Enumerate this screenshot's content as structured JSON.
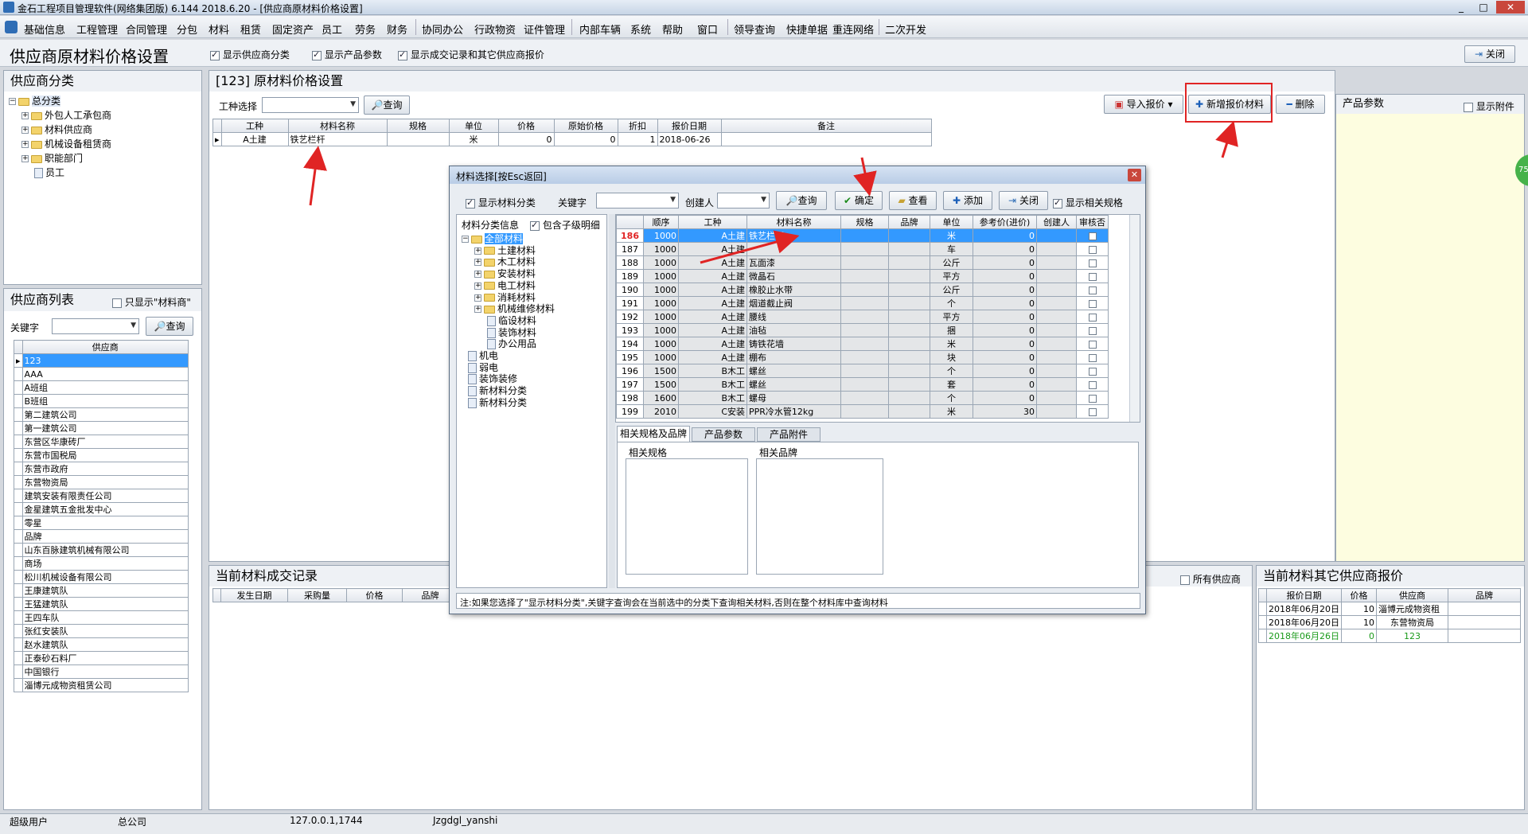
{
  "window": {
    "title": "金石工程项目管理软件(网络集团版) 6.144  2018.6.20 - [供应商原材料价格设置]"
  },
  "menu": [
    "基础信息",
    "工程管理",
    "合同管理",
    "分包",
    "材料",
    "租赁",
    "固定资产",
    "员工",
    "劳务",
    "财务",
    "协同办公",
    "行政物资",
    "证件管理",
    "内部车辆",
    "系统",
    "帮助",
    "窗口",
    "领导查询",
    "快捷单据",
    "重连网络",
    "二次开发"
  ],
  "header": {
    "title": "供应商原材料价格设置",
    "opt1": "显示供应商分类",
    "opt2": "显示产品参数",
    "opt3": "显示成交记录和其它供应商报价",
    "close": "关闭"
  },
  "supplier_category": {
    "title": "供应商分类",
    "root": "总分类",
    "items": [
      "外包人工承包商",
      "材料供应商",
      "机械设备租赁商",
      "职能部门",
      "员工"
    ]
  },
  "supplier_list": {
    "title": "供应商列表",
    "only_material": "只显示\"材料商\"",
    "keyword_label": "关键字",
    "query": "查询",
    "col": "供应商",
    "rows": [
      "123",
      "AAA",
      "A班组",
      "B班组",
      "第二建筑公司",
      "第一建筑公司",
      "东营区华康砖厂",
      "东营市国税局",
      "东营市政府",
      "东营物资局",
      "建筑安装有限责任公司",
      "金星建筑五金批发中心",
      "零星",
      "品牌",
      "山东百脉建筑机械有限公司",
      "商场",
      "松川机械设备有限公司",
      "王康建筑队",
      "王猛建筑队",
      "王四车队",
      "张红安装队",
      "赵水建筑队",
      "正泰砂石料厂",
      "中国银行",
      "淄博元成物资租赁公司"
    ]
  },
  "price_panel": {
    "title": "[123]  原材料价格设置",
    "trade_label": "工种选择",
    "query": "查询",
    "import": "导入报价",
    "add": "新增报价材料",
    "delete": "删除",
    "cols": [
      "工种",
      "材料名称",
      "规格",
      "单位",
      "价格",
      "原始价格",
      "折扣",
      "报价日期",
      "备注"
    ],
    "row": [
      "A土建",
      "铁艺栏杆",
      "",
      "米",
      "0",
      "0",
      "1",
      "2018-06-26",
      ""
    ]
  },
  "product_params": {
    "title": "产品参数",
    "show_attach": "显示附件"
  },
  "deal_records": {
    "title": "当前材料成交记录",
    "all_suppliers": "所有供应商",
    "cols": [
      "发生日期",
      "采购量",
      "价格",
      "品牌"
    ]
  },
  "other_quotes": {
    "title": "当前材料其它供应商报价",
    "cols": [
      "报价日期",
      "价格",
      "供应商",
      "品牌"
    ],
    "rows": [
      [
        "2018年06月20日",
        "10",
        "淄博元成物资租",
        "",
        ""
      ],
      [
        "2018年06月20日",
        "10",
        "东营物资局",
        ""
      ],
      [
        "2018年06月26日",
        "0",
        "123",
        ""
      ]
    ]
  },
  "dialog": {
    "title": "材料选择[按Esc返回]",
    "show_cat": "显示材料分类",
    "keyword": "关键字",
    "creator": "创建人",
    "query": "查询",
    "ok": "确定",
    "view": "查看",
    "add": "添加",
    "close": "关闭",
    "show_spec": "显示相关规格",
    "cat_label": "材料分类信息",
    "include_sub": "包含子级明细",
    "tree": [
      "全部材料",
      "土建材料",
      "木工材料",
      "安装材料",
      "电工材料",
      "消耗材料",
      "机械维修材料",
      "临设材料",
      "装饰材料",
      "办公用品",
      "机电",
      "弱电",
      "装饰装修",
      "新材料分类",
      "新材料分类"
    ],
    "cols": [
      "顺序",
      "工种",
      "材料名称",
      "规格",
      "品牌",
      "单位",
      "参考价(进价)",
      "创建人",
      "审核否"
    ],
    "rows": [
      [
        "186",
        "1000",
        "A土建",
        "铁艺栏杆",
        "",
        "",
        "米",
        "0",
        ""
      ],
      [
        "187",
        "1000",
        "A土建",
        "",
        "",
        "",
        "车",
        "0",
        ""
      ],
      [
        "188",
        "1000",
        "A土建",
        "瓦面漆",
        "",
        "",
        "公斤",
        "0",
        ""
      ],
      [
        "189",
        "1000",
        "A土建",
        "微晶石",
        "",
        "",
        "平方",
        "0",
        ""
      ],
      [
        "190",
        "1000",
        "A土建",
        "橡胶止水带",
        "",
        "",
        "公斤",
        "0",
        ""
      ],
      [
        "191",
        "1000",
        "A土建",
        "烟道截止阀",
        "",
        "",
        "个",
        "0",
        ""
      ],
      [
        "192",
        "1000",
        "A土建",
        "腰线",
        "",
        "",
        "平方",
        "0",
        ""
      ],
      [
        "193",
        "1000",
        "A土建",
        "油毡",
        "",
        "",
        "捆",
        "0",
        ""
      ],
      [
        "194",
        "1000",
        "A土建",
        "铸铁花墙",
        "",
        "",
        "米",
        "0",
        ""
      ],
      [
        "195",
        "1000",
        "A土建",
        "棚布",
        "",
        "",
        "块",
        "0",
        ""
      ],
      [
        "196",
        "1500",
        "B木工",
        "螺丝",
        "",
        "",
        "个",
        "0",
        ""
      ],
      [
        "197",
        "1500",
        "B木工",
        "螺丝",
        "",
        "",
        "套",
        "0",
        ""
      ],
      [
        "198",
        "1600",
        "B木工",
        "螺母",
        "",
        "",
        "个",
        "0",
        ""
      ],
      [
        "199",
        "2010",
        "C安装",
        "PPR冷水管12kg",
        "",
        "",
        "米",
        "30",
        ""
      ]
    ],
    "tabs": [
      "相关规格及品牌",
      "产品参数",
      "产品附件"
    ],
    "spec_label": "相关规格",
    "brand_label": "相关品牌",
    "note": "注:如果您选择了\"显示材料分类\",关键字查询会在当前选中的分类下查询相关材料,否则在整个材料库中查询材料"
  },
  "status": {
    "user": "超级用户",
    "company": "总公司",
    "ip": "127.0.0.1,1744",
    "db": "Jzgdgl_yanshi"
  }
}
